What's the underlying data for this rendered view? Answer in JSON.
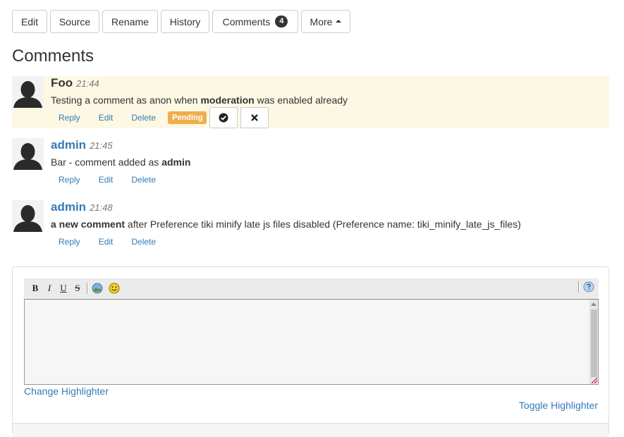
{
  "toolbar": {
    "edit": "Edit",
    "source": "Source",
    "rename": "Rename",
    "history": "History",
    "comments": "Comments",
    "comments_count": "4",
    "more": "More"
  },
  "page_title": "Comments",
  "comments": [
    {
      "author": "Foo",
      "time": "21:44",
      "body_before": "Testing a comment as anon when ",
      "body_bold": "moderation",
      "body_after": " was enabled already",
      "reply": "Reply",
      "edit": "Edit",
      "delete": "Delete",
      "status": "Pending"
    },
    {
      "author": "admin",
      "time": "21:45",
      "body_before": "Bar - comment added as ",
      "body_bold": "admin",
      "body_after": "",
      "reply": "Reply",
      "edit": "Edit",
      "delete": "Delete"
    },
    {
      "author": "admin",
      "time": "21:48",
      "body_bold": "a new comment",
      "body_after": " after Preference tiki minify late js files disabled (Preference name: tiki_minify_late_js_files)",
      "reply": "Reply",
      "edit": "Edit",
      "delete": "Delete"
    }
  ],
  "editor": {
    "bold": "B",
    "italic": "I",
    "underline": "U",
    "strike": "S",
    "change_highlighter": "Change Highlighter",
    "toggle_highlighter": "Toggle Highlighter"
  },
  "colors": {
    "link": "#337ab7",
    "pending_bg": "#fcf8e3",
    "pending_label": "#f0ad4e"
  }
}
